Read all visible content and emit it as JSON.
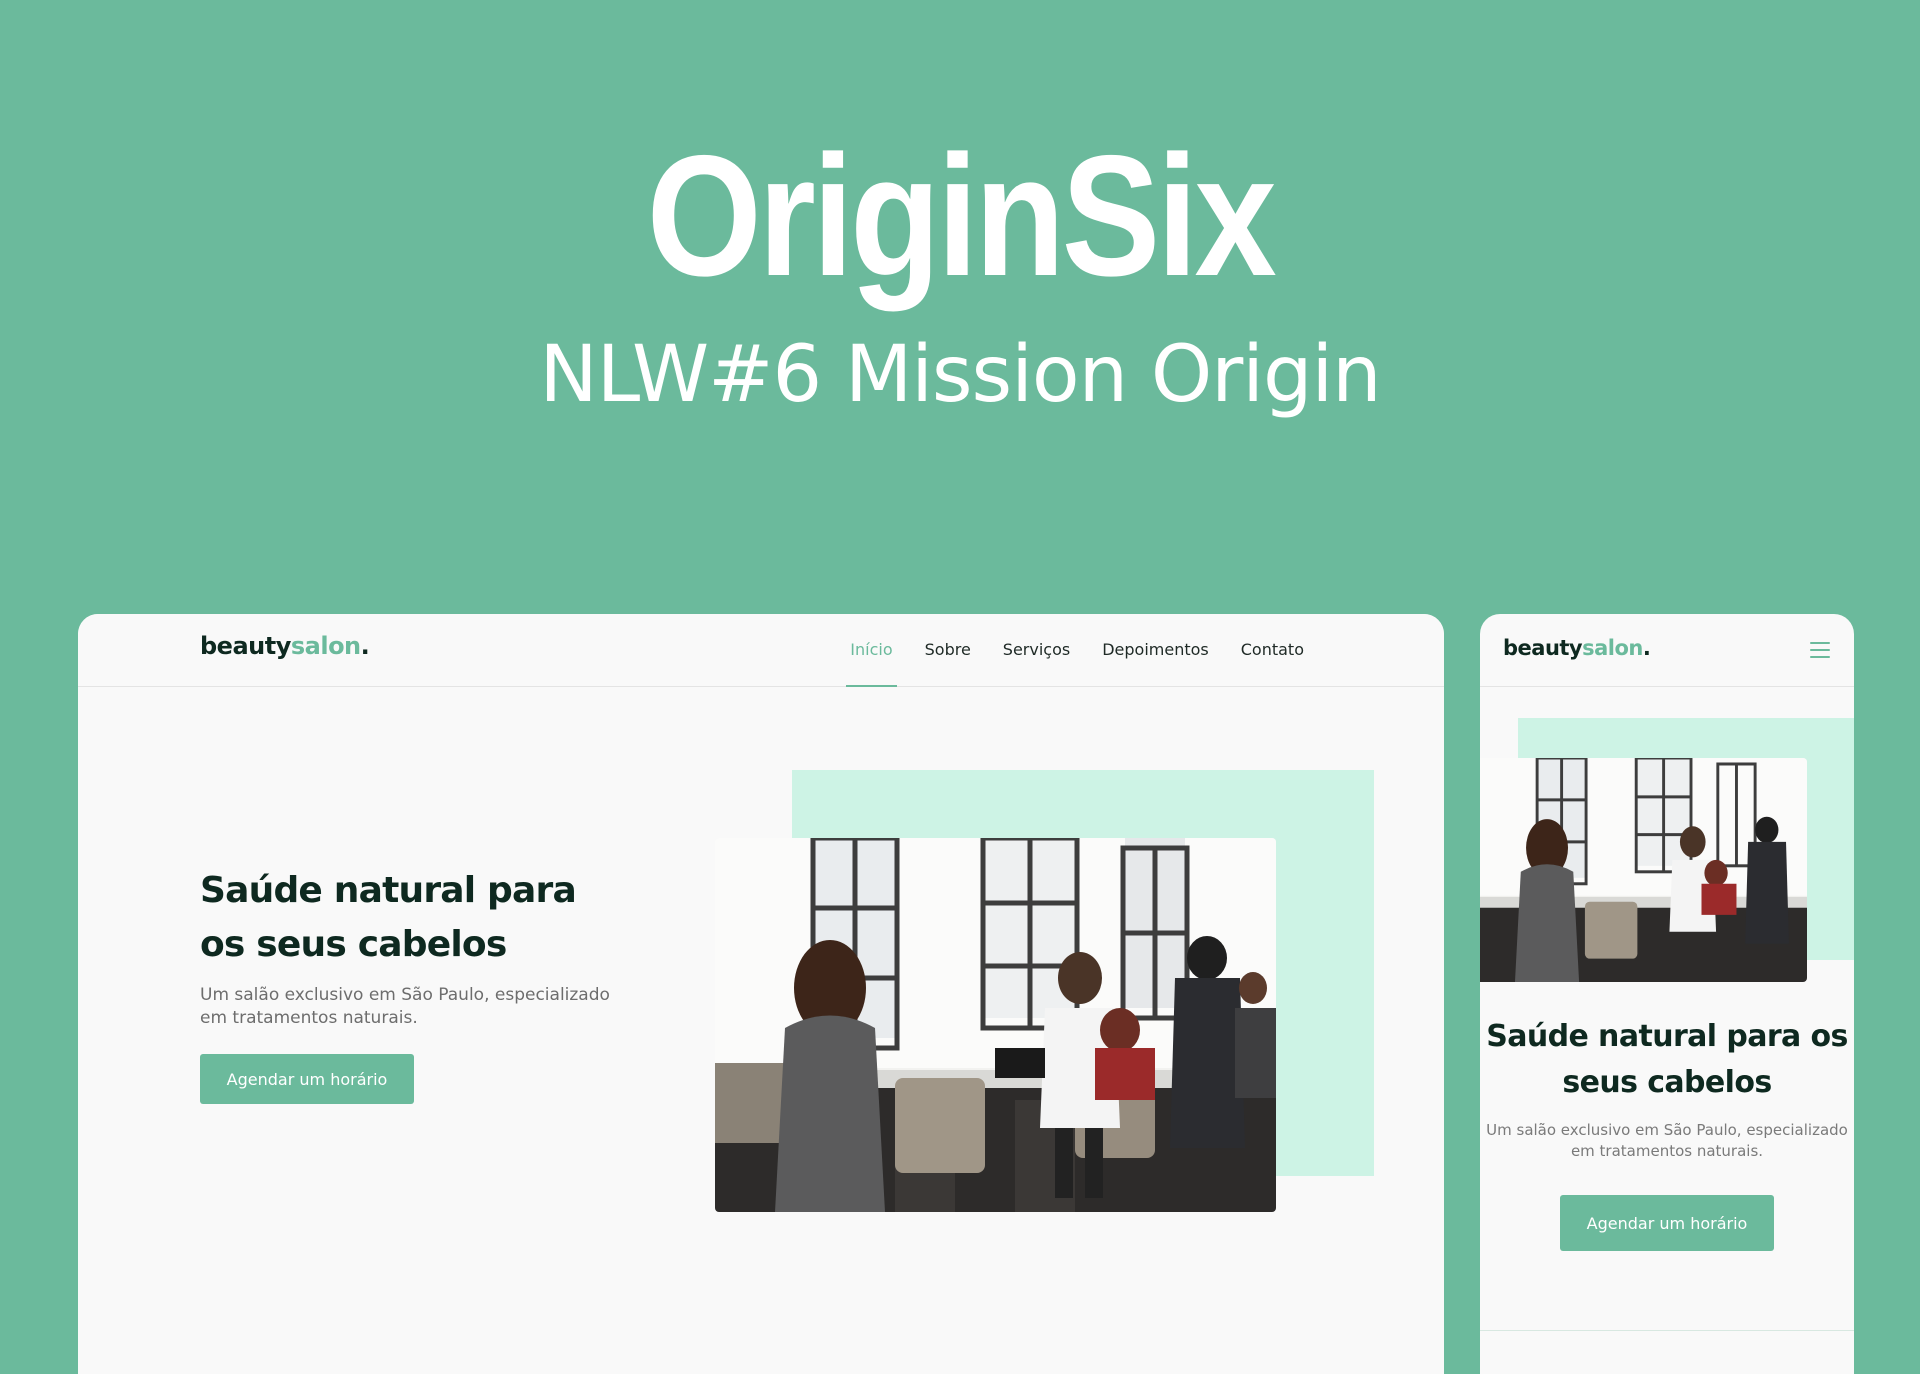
{
  "hero": {
    "title": "OriginSix",
    "subtitle": "NLW#6 Mission Origin"
  },
  "brand": {
    "logo_main": "beauty",
    "logo_accent": "salon",
    "logo_dot": ".",
    "accent_color": "#6bba9c",
    "dark_color": "#0e2920",
    "light_accent": "#cdf3e5"
  },
  "desktop": {
    "nav": [
      {
        "label": "Início",
        "active": true
      },
      {
        "label": "Sobre",
        "active": false
      },
      {
        "label": "Serviços",
        "active": false
      },
      {
        "label": "Depoimentos",
        "active": false
      },
      {
        "label": "Contato",
        "active": false
      }
    ],
    "headline": "Saúde natural para os seus cabelos",
    "description": "Um salão exclusivo em São Paulo, especializado em tratamentos naturais.",
    "cta": "Agendar um horário",
    "image_icon": "salon-photo"
  },
  "mobile": {
    "menu_icon": "hamburger-menu-icon",
    "headline": "Saúde natural para os seus cabelos",
    "description": "Um salão exclusivo em São Paulo, especializado em tratamentos naturais.",
    "cta": "Agendar um horário",
    "image_icon": "salon-photo"
  }
}
